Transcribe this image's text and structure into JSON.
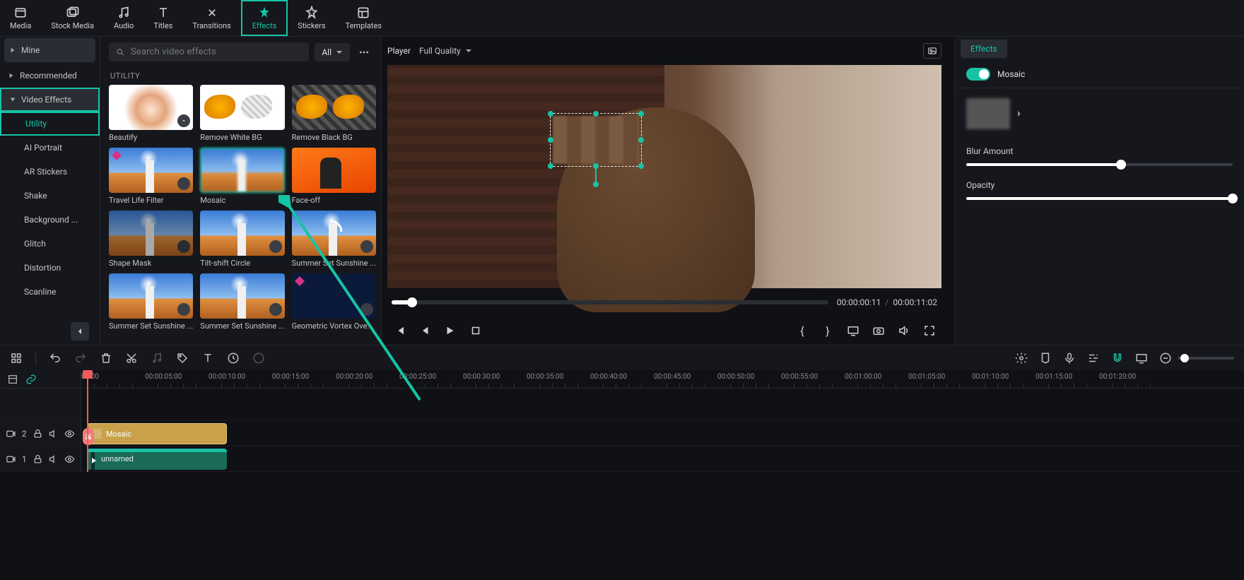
{
  "top_tabs": {
    "media": "Media",
    "stock_media": "Stock Media",
    "audio": "Audio",
    "titles": "Titles",
    "transitions": "Transitions",
    "effects": "Effects",
    "stickers": "Stickers",
    "templates": "Templates"
  },
  "sidebar": {
    "mine": "Mine",
    "recommended": "Recommended",
    "video_effects": "Video Effects",
    "utility": "Utility",
    "ai_portrait": "AI Portrait",
    "ar_stickers": "AR Stickers",
    "shake": "Shake",
    "background": "Background ...",
    "glitch": "Glitch",
    "distortion": "Distortion",
    "scanline": "Scanline"
  },
  "browser": {
    "search_placeholder": "Search video effects",
    "all_label": "All",
    "section": "UTILITY",
    "cells": {
      "beautify": "Beautify",
      "remove_white": "Remove White BG",
      "remove_black": "Remove Black BG",
      "travel": "Travel Life Filter",
      "mosaic": "Mosaic",
      "faceoff": "Face-off",
      "shape_mask": "Shape Mask",
      "tilt_shift": "Tilt-shift Circle",
      "summer1": "Summer Set Sunshine ...",
      "summer2": "Summer Set Sunshine ...",
      "summer3": "Summer Set Sunshine ...",
      "geometric": "Geometric Vortex Ove..."
    }
  },
  "player": {
    "label": "Player",
    "quality": "Full Quality",
    "current": "00:00:00:11",
    "separator": "/",
    "total": "00:00:11:02"
  },
  "right": {
    "tab": "Effects",
    "name": "Mosaic",
    "blur_label": "Blur Amount",
    "opacity_label": "Opacity",
    "blur_pct": 58,
    "opacity_pct": 100
  },
  "timeline": {
    "ticks": [
      "00:00",
      "00:00:05:00",
      "00:00:10:00",
      "00:00:15:00",
      "00:00:20:00",
      "00:00:25:00",
      "00:00:30:00",
      "00:00:35:00",
      "00:00:40:00",
      "00:00:45:00",
      "00:00:50:00",
      "00:00:55:00",
      "00:01:00:00",
      "00:01:05:00",
      "00:01:10:00",
      "00:01:15:00",
      "00:01:20:00"
    ],
    "fx_clip": "Mosaic",
    "video_clip": "unnamed",
    "track2": "2",
    "track1": "1"
  }
}
